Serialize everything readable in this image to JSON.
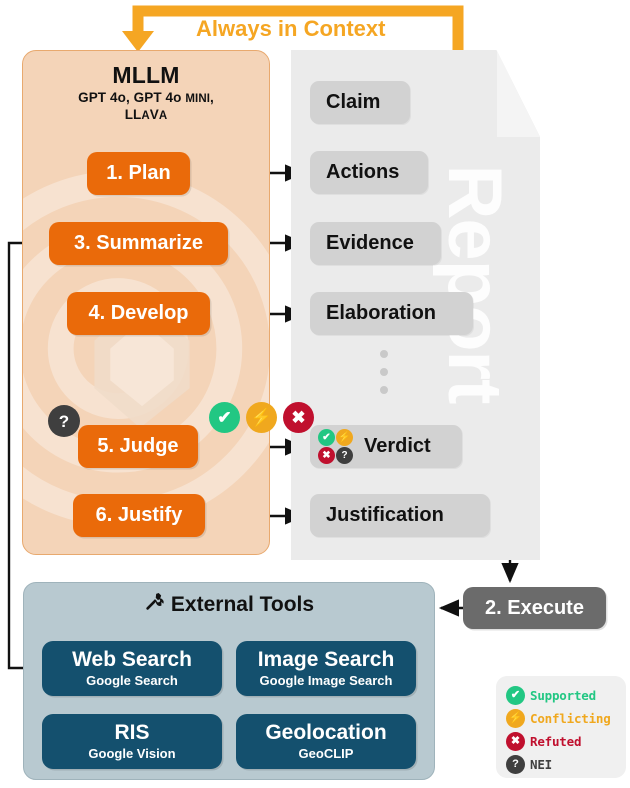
{
  "colors": {
    "orange_step": "#ea6a0a",
    "orange_accent": "#f5a623",
    "mllm_bg": "#f4d4b8",
    "report_bg": "#ebebeb",
    "report_box": "#d2d2d2",
    "tools_bg": "#b8c9d0",
    "tool_card": "#14506e",
    "execute_gray": "#6b6b6b",
    "supported_green": "#22c783",
    "conflicting_amber": "#f0a81e",
    "refuted_crimson": "#c0102e",
    "nei_gray": "#3f3f3f"
  },
  "context_banner": {
    "label": "Always in Context"
  },
  "mllm": {
    "title": "MLLM",
    "subtitle_line1_a": "GPT 4o, GPT 4o ",
    "subtitle_line1_b": "MINI",
    "subtitle_line1_c": ",",
    "subtitle_line2_a": "LL",
    "subtitle_line2_b": "A",
    "subtitle_line2_c": "V",
    "subtitle_line2_d": "A",
    "subtitle_full": "GPT 4o, GPT 4o MINI, LLaVa",
    "steps": [
      {
        "id": "plan",
        "label": "1. Plan"
      },
      {
        "id": "summarize",
        "label": "3. Summarize"
      },
      {
        "id": "develop",
        "label": "4. Develop"
      },
      {
        "id": "judge",
        "label": "5. Judge"
      },
      {
        "id": "justify",
        "label": "6. Justify"
      }
    ]
  },
  "execute": {
    "label": "2. Execute"
  },
  "report": {
    "watermark": "Report",
    "boxes": [
      {
        "id": "claim",
        "label": "Claim"
      },
      {
        "id": "actions",
        "label": "Actions"
      },
      {
        "id": "evidence",
        "label": "Evidence"
      },
      {
        "id": "elaboration",
        "label": "Elaboration"
      },
      {
        "id": "verdict",
        "label": "Verdict"
      },
      {
        "id": "justification",
        "label": "Justification"
      }
    ],
    "ellipsis_dots": 3
  },
  "badges": {
    "supported": {
      "icon": "check-icon",
      "glyph": "✔",
      "color": "#22c783"
    },
    "conflicting": {
      "icon": "lightning-icon",
      "glyph": "⚡",
      "color": "#f0a81e"
    },
    "refuted": {
      "icon": "cross-icon",
      "glyph": "✖",
      "color": "#c0102e"
    },
    "nei": {
      "icon": "question-icon",
      "glyph": "?",
      "color": "#3f3f3f"
    }
  },
  "tools": {
    "title": "External Tools",
    "title_icon": "hammer-and-wrench-icon",
    "title_icon_glyph": "🛠",
    "cards": [
      {
        "id": "web-search",
        "title": "Web Search",
        "subtitle": "Google Search"
      },
      {
        "id": "image-search",
        "title": "Image Search",
        "subtitle": "Google Image Search"
      },
      {
        "id": "ris",
        "title": "RIS",
        "subtitle": "Google Vision"
      },
      {
        "id": "geolocation",
        "title": "Geolocation",
        "subtitle": "GeoCLIP"
      }
    ]
  },
  "legend": {
    "items": [
      {
        "id": "supported",
        "label": "Supported",
        "color": "#22c783",
        "text_color": "#22c783",
        "glyph": "✔"
      },
      {
        "id": "conflicting",
        "label": "Conflicting",
        "color": "#f0a81e",
        "text_color": "#f0a81e",
        "glyph": "⚡"
      },
      {
        "id": "refuted",
        "label": "Refuted",
        "color": "#c0102e",
        "text_color": "#c0102e",
        "glyph": "✖"
      },
      {
        "id": "nei",
        "label": "NEI",
        "color": "#3f3f3f",
        "text_color": "#3f3f3f",
        "glyph": "?"
      }
    ]
  }
}
